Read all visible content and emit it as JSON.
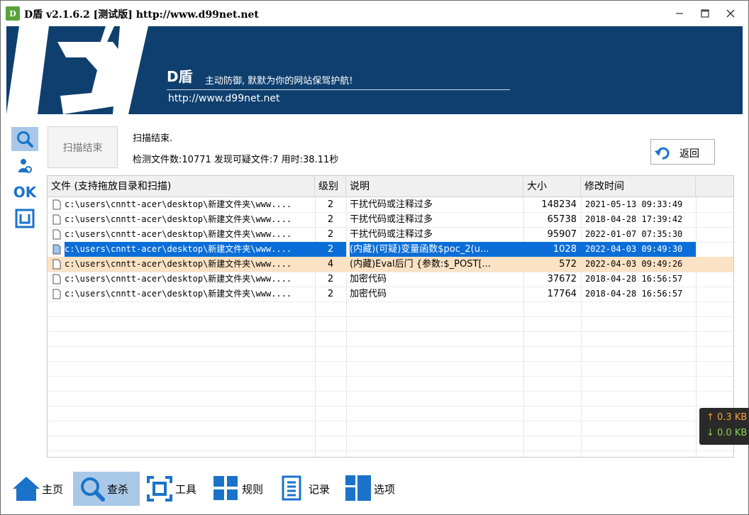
{
  "window": {
    "app_icon_text": "D",
    "title": "D盾 v2.1.6.2 [测试版] http://www.d99net.net"
  },
  "banner": {
    "brand": "D盾",
    "slogan": "主动防御, 默默为你的网站保驾护航!",
    "url": "http://www.d99net.net"
  },
  "side_tools": [
    {
      "name": "scan-tool",
      "icon": "search-icon"
    },
    {
      "name": "users-tool",
      "icon": "user-icon"
    },
    {
      "name": "ok-tool",
      "icon": "ok-icon",
      "text": "OK"
    },
    {
      "name": "frame-tool",
      "icon": "frame-icon"
    }
  ],
  "scan": {
    "button_label": "扫描结束",
    "status": "扫描结束.",
    "summary": "检测文件数:10771 发现可疑文件:7 用时:38.11秒",
    "back_label": "返回"
  },
  "table": {
    "columns": [
      "文件 (支持拖放目录和扫描)",
      "级别",
      "说明",
      "大小",
      "修改时间"
    ],
    "rows": [
      {
        "file": "c:\\users\\cnntt-acer\\desktop\\新建文件夹\\www....",
        "level": "2",
        "desc": "干扰代码或注释过多",
        "size": "148234",
        "mtime": "2021-05-13 09:33:49",
        "state": "normal"
      },
      {
        "file": "c:\\users\\cnntt-acer\\desktop\\新建文件夹\\www....",
        "level": "2",
        "desc": "干扰代码或注释过多",
        "size": "65738",
        "mtime": "2018-04-28 17:39:42",
        "state": "normal"
      },
      {
        "file": "c:\\users\\cnntt-acer\\desktop\\新建文件夹\\www....",
        "level": "2",
        "desc": "干扰代码或注释过多",
        "size": "95907",
        "mtime": "2022-01-07 07:35:30",
        "state": "normal"
      },
      {
        "file": "c:\\users\\cnntt-acer\\desktop\\新建文件夹\\www....",
        "level": "2",
        "desc": "(内藏)(可疑)变量函数$poc_2(u...",
        "size": "1028",
        "mtime": "2022-04-03 09:49:30",
        "state": "selected"
      },
      {
        "file": "c:\\users\\cnntt-acer\\desktop\\新建文件夹\\www....",
        "level": "4",
        "desc": "(内藏)Eval后门 {参数:$_POST[...",
        "size": "572",
        "mtime": "2022-04-03 09:49:26",
        "state": "warn"
      },
      {
        "file": "c:\\users\\cnntt-acer\\desktop\\新建文件夹\\www....",
        "level": "2",
        "desc": "加密代码",
        "size": "37672",
        "mtime": "2018-04-28 16:56:57",
        "state": "normal"
      },
      {
        "file": "c:\\users\\cnntt-acer\\desktop\\新建文件夹\\www....",
        "level": "2",
        "desc": "加密代码",
        "size": "17764",
        "mtime": "2018-04-28 16:56:57",
        "state": "normal"
      }
    ]
  },
  "speed": {
    "up": "↑ 0.3 KB",
    "down": "↓ 0.0 KB"
  },
  "nav": [
    {
      "label": "主页",
      "icon": "home-icon"
    },
    {
      "label": "查杀",
      "icon": "search-icon",
      "active": true
    },
    {
      "label": "工具",
      "icon": "tool-icon"
    },
    {
      "label": "规则",
      "icon": "grid-icon"
    },
    {
      "label": "记录",
      "icon": "log-icon"
    },
    {
      "label": "选项",
      "icon": "options-icon"
    }
  ],
  "colors": {
    "banner_bg": "#0f3f6e",
    "selected_row": "#0b6ed8",
    "warn_row": "#fbe2c4",
    "active_tool": "#a9c8e8",
    "icon_blue": "#1a73c9"
  }
}
